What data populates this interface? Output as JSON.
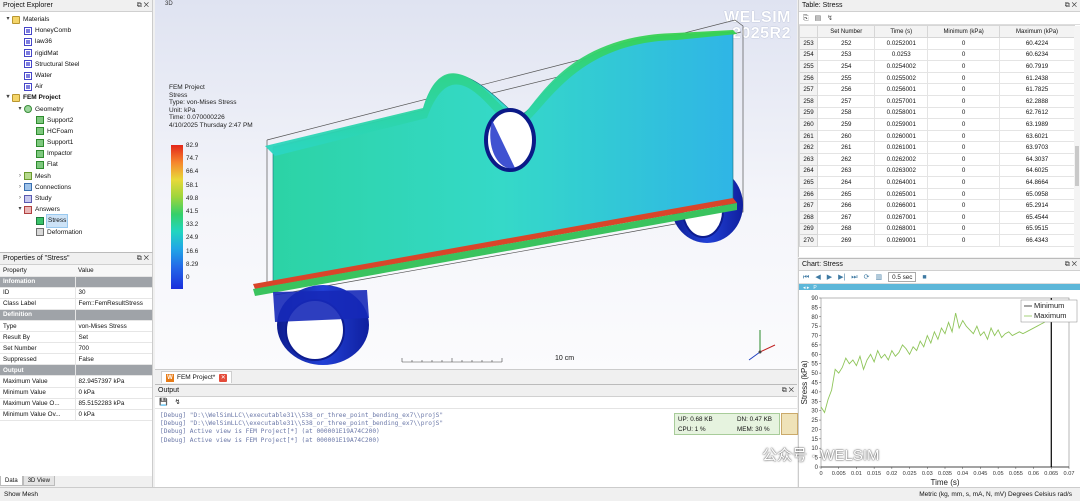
{
  "project_explorer": {
    "title": "Project Explorer",
    "items": [
      {
        "label": "Materials",
        "icon": "folder-icon",
        "toggle": "▾"
      },
      {
        "label": "HoneyComb",
        "icon": "material-icon",
        "toggle": ""
      },
      {
        "label": "law36",
        "icon": "material-icon",
        "toggle": ""
      },
      {
        "label": "rigidMat",
        "icon": "material-icon",
        "toggle": ""
      },
      {
        "label": "Structural Steel",
        "icon": "material-icon",
        "toggle": ""
      },
      {
        "label": "Water",
        "icon": "material-icon",
        "toggle": ""
      },
      {
        "label": "Air",
        "icon": "material-icon",
        "toggle": ""
      },
      {
        "label": "FEM Project",
        "icon": "folder-icon",
        "toggle": "▾"
      },
      {
        "label": "Geometry",
        "icon": "geometry-icon",
        "toggle": "▾"
      },
      {
        "label": "Support2",
        "icon": "part-icon",
        "toggle": ""
      },
      {
        "label": "HCFoam",
        "icon": "part-icon",
        "toggle": ""
      },
      {
        "label": "Support1",
        "icon": "part-icon",
        "toggle": ""
      },
      {
        "label": "Impactor",
        "icon": "part-icon",
        "toggle": ""
      },
      {
        "label": "Flat",
        "icon": "part-icon",
        "toggle": ""
      },
      {
        "label": "Mesh",
        "icon": "mesh-icon",
        "toggle": "›"
      },
      {
        "label": "Connections",
        "icon": "connections-icon",
        "toggle": "›"
      },
      {
        "label": "Study",
        "icon": "study-icon",
        "toggle": "›"
      },
      {
        "label": "Answers",
        "icon": "answers-icon",
        "toggle": "▾"
      },
      {
        "label": "Stress",
        "icon": "stress-icon",
        "toggle": ""
      },
      {
        "label": "Deformation",
        "icon": "deformation-icon",
        "toggle": ""
      }
    ]
  },
  "properties": {
    "title": "Properties of \"Stress\"",
    "header": {
      "property": "Property",
      "value": "Value"
    },
    "rows": [
      {
        "type": "group",
        "k": "Infomation",
        "v": ""
      },
      {
        "type": "row",
        "k": "ID",
        "v": "30"
      },
      {
        "type": "row",
        "k": "Class Label",
        "v": "Fem::FemResultStress"
      },
      {
        "type": "group",
        "k": "Definition",
        "v": ""
      },
      {
        "type": "row",
        "k": "Type",
        "v": "von-Mises Stress"
      },
      {
        "type": "row",
        "k": "Result By",
        "v": "Set"
      },
      {
        "type": "row",
        "k": "Set Number",
        "v": "700"
      },
      {
        "type": "row",
        "k": "Suppressed",
        "v": "False"
      },
      {
        "type": "group",
        "k": "Output",
        "v": ""
      },
      {
        "type": "row",
        "k": "Maximum Value",
        "v": "82.9457397 kPa"
      },
      {
        "type": "row",
        "k": "Minimum Value",
        "v": "0 kPa"
      },
      {
        "type": "row",
        "k": "Maximum Value O...",
        "v": "85.5152283 kPa"
      },
      {
        "type": "row",
        "k": "Minimum Value Ov...",
        "v": "0 kPa"
      }
    ],
    "tabs": [
      "Data",
      "3D View"
    ]
  },
  "view3d": {
    "tag": "3D",
    "logo_line1": "WELSIM",
    "logo_line2": "2025R2",
    "info": [
      "FEM Project",
      "Stress",
      "Type: von-Mises Stress",
      "Unit: kPa",
      "Time: 0.070000226",
      "4/10/2025 Thursday 2:47 PM"
    ],
    "legend": [
      "82.9",
      "74.7",
      "66.4",
      "58.1",
      "49.8",
      "41.5",
      "33.2",
      "24.9",
      "16.6",
      "8.29",
      "0"
    ],
    "scale_label": "10 cm"
  },
  "doc_tab": {
    "label": "FEM Project*"
  },
  "output": {
    "title": "Output",
    "lines": [
      "[Debug]  \"D:\\\\WelSimLLC\\\\executable31\\\\538_or_three_point_bending_ex7\\\\projS\"",
      "[Debug]  \"D:\\\\WelSimLLC\\\\executable31\\\\538_or_three_point_bending_ex7\\\\projS\"",
      "[Debug] Active view is FEM Project[*] (at 000001E19A74C200)",
      "[Debug] Active view is FEM Project[*] (at 000001E19A74C200)"
    ],
    "monitor": {
      "up": "UP: 0.68 KB",
      "dn": "DN: 0.47 KB",
      "cpu": "CPU: 1 %",
      "mem": "MEM: 30 %"
    }
  },
  "table": {
    "title": "Table: Stress",
    "headers": [
      "",
      "Set Number",
      "Time (s)",
      "Minimum (kPa)",
      "Maximum (kPa)"
    ],
    "rows": [
      [
        "253",
        "252",
        "0.0252001",
        "0",
        "60.4224"
      ],
      [
        "254",
        "253",
        "0.0253",
        "0",
        "60.6234"
      ],
      [
        "255",
        "254",
        "0.0254002",
        "0",
        "60.7919"
      ],
      [
        "256",
        "255",
        "0.0255002",
        "0",
        "61.2438"
      ],
      [
        "257",
        "256",
        "0.0256001",
        "0",
        "61.7825"
      ],
      [
        "258",
        "257",
        "0.0257001",
        "0",
        "62.2888"
      ],
      [
        "259",
        "258",
        "0.0258001",
        "0",
        "62.7612"
      ],
      [
        "260",
        "259",
        "0.0259001",
        "0",
        "63.1989"
      ],
      [
        "261",
        "260",
        "0.0260001",
        "0",
        "63.6021"
      ],
      [
        "262",
        "261",
        "0.0261001",
        "0",
        "63.9703"
      ],
      [
        "263",
        "262",
        "0.0262002",
        "0",
        "64.3037"
      ],
      [
        "264",
        "263",
        "0.0263002",
        "0",
        "64.6025"
      ],
      [
        "265",
        "264",
        "0.0264001",
        "0",
        "64.8664"
      ],
      [
        "266",
        "265",
        "0.0265001",
        "0",
        "65.0958"
      ],
      [
        "267",
        "266",
        "0.0266001",
        "0",
        "65.2914"
      ],
      [
        "268",
        "267",
        "0.0267001",
        "0",
        "65.4544"
      ],
      [
        "269",
        "268",
        "0.0268001",
        "0",
        "65.9515"
      ],
      [
        "270",
        "269",
        "0.0269001",
        "0",
        "66.4343"
      ]
    ]
  },
  "chart": {
    "title": "Chart: Stress",
    "speed": "0.5 sec",
    "p_label": "P"
  },
  "chart_data": {
    "type": "line",
    "xlabel": "Time (s)",
    "ylabel": "Stress (kPa)",
    "xlim": [
      0,
      0.07
    ],
    "ylim": [
      0,
      90
    ],
    "xticks": [
      "0",
      "0.005",
      "0.01",
      "0.015",
      "0.02",
      "0.025",
      "0.03",
      "0.035",
      "0.04",
      "0.045",
      "0.05",
      "0.055",
      "0.06",
      "0.065",
      "0.07"
    ],
    "yticks": [
      "0",
      "5",
      "10",
      "15",
      "20",
      "25",
      "30",
      "35",
      "40",
      "45",
      "50",
      "55",
      "60",
      "65",
      "70",
      "75",
      "80",
      "85",
      "90"
    ],
    "legend_position": "top-right",
    "series": [
      {
        "name": "Minimum",
        "x": [
          0,
          0.07
        ],
        "y": [
          0,
          0
        ]
      },
      {
        "name": "Maximum",
        "x": [
          0.0,
          0.001,
          0.002,
          0.003,
          0.004,
          0.005,
          0.006,
          0.007,
          0.008,
          0.009,
          0.01,
          0.011,
          0.012,
          0.013,
          0.014,
          0.015,
          0.016,
          0.017,
          0.018,
          0.019,
          0.02,
          0.021,
          0.022,
          0.023,
          0.024,
          0.025,
          0.026,
          0.027,
          0.028,
          0.029,
          0.03,
          0.031,
          0.032,
          0.033,
          0.034,
          0.035,
          0.036,
          0.037,
          0.038,
          0.039,
          0.04,
          0.041,
          0.042,
          0.043,
          0.044,
          0.045,
          0.046,
          0.047,
          0.048,
          0.049,
          0.05,
          0.051,
          0.052,
          0.053,
          0.054,
          0.055,
          0.056,
          0.057,
          0.058,
          0.059,
          0.06,
          0.061,
          0.062,
          0.063,
          0.064,
          0.065
        ],
        "y": [
          32,
          29,
          36,
          41,
          52,
          50,
          53,
          58,
          55,
          57,
          54,
          59,
          52,
          57,
          60,
          56,
          62,
          58,
          60,
          57,
          62,
          59,
          61,
          65,
          63,
          60,
          64,
          62,
          67,
          64,
          70,
          66,
          72,
          68,
          74,
          71,
          77,
          72,
          82,
          74,
          78,
          75,
          73,
          71,
          75,
          70,
          72,
          68,
          74,
          70,
          73,
          69,
          71,
          72,
          70,
          71,
          72,
          71,
          72,
          73,
          74,
          75,
          76,
          77,
          80,
          82
        ]
      }
    ]
  },
  "statusbar": {
    "left": "Show Mesh",
    "right": "Metric (kg, mm, s, mA, N, mV)  Degrees  Celsius  rad/s"
  },
  "watermark": "公众号 · WELSIM",
  "colors": {
    "accent": "#3f7aa3",
    "legend_top": "#e32619",
    "legend_bottom": "#1b2fdc",
    "model_face": "#2fd6b4",
    "supports": "#1428b4",
    "chart_line": "#8fc55a"
  }
}
